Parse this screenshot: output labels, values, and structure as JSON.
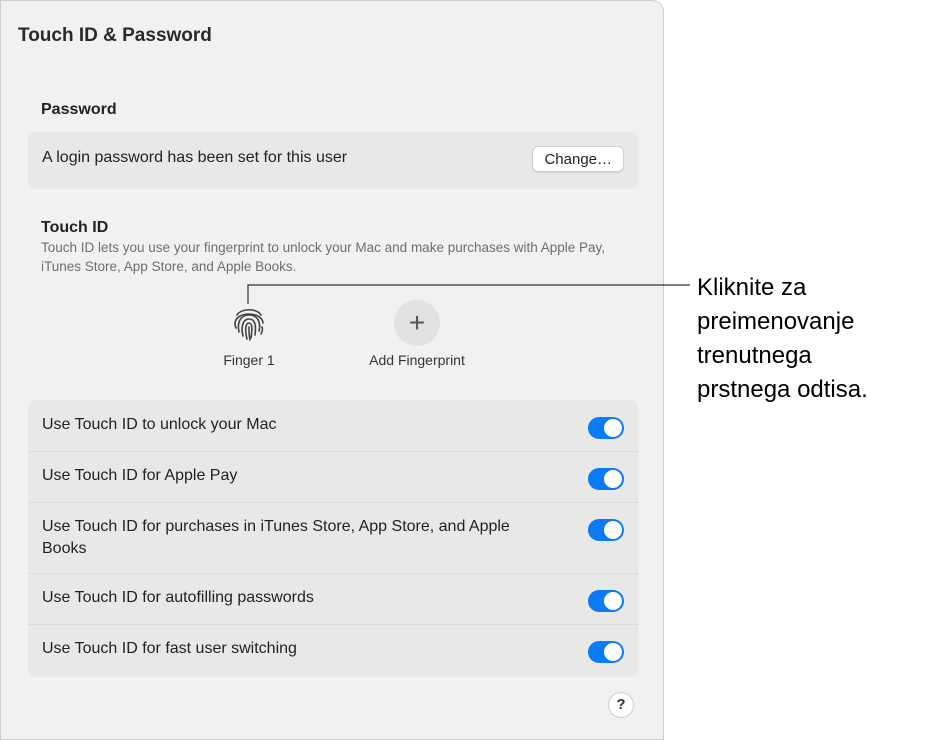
{
  "window": {
    "title": "Touch ID & Password"
  },
  "password": {
    "heading": "Password",
    "status_text": "A login password has been set for this user",
    "change_label": "Change…"
  },
  "touchid": {
    "heading": "Touch ID",
    "description": "Touch ID lets you use your fingerprint to unlock your Mac and make purchases with Apple Pay, iTunes Store, App Store, and Apple Books.",
    "fingerprints": [
      {
        "label": "Finger 1",
        "icon": "fingerprint-icon"
      },
      {
        "label": "Add Fingerprint",
        "icon": "plus-icon"
      }
    ],
    "options": [
      {
        "label": "Use Touch ID to unlock your Mac",
        "enabled": true
      },
      {
        "label": "Use Touch ID for Apple Pay",
        "enabled": true
      },
      {
        "label": "Use Touch ID for purchases in iTunes Store, App Store, and Apple Books",
        "enabled": true
      },
      {
        "label": "Use Touch ID for autofilling passwords",
        "enabled": true
      },
      {
        "label": "Use Touch ID for fast user switching",
        "enabled": true
      }
    ]
  },
  "help_label": "?",
  "callout": {
    "lines": [
      "Kliknite za",
      "preimenovanje",
      "trenutnega",
      "prstnega odtisa."
    ]
  },
  "colors": {
    "toggle_on": "#0a7bf4",
    "panel_bg": "#f2f1f2",
    "card_bg": "#e9e8e9"
  }
}
